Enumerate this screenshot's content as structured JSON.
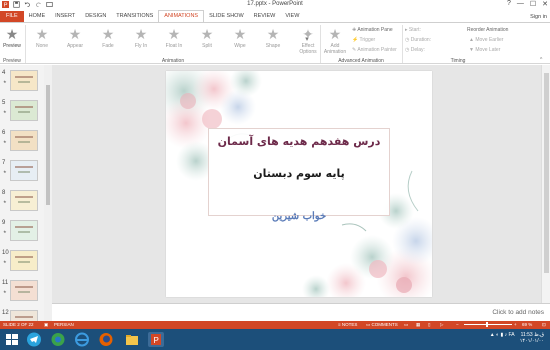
{
  "window": {
    "title": "17.pptx - PowerPoint",
    "controls": [
      "?",
      "—",
      "☐",
      "✕"
    ],
    "sign_in": "Sign in"
  },
  "tabs": [
    {
      "label": "FILE"
    },
    {
      "label": "HOME"
    },
    {
      "label": "INSERT"
    },
    {
      "label": "DESIGN"
    },
    {
      "label": "TRANSITIONS"
    },
    {
      "label": "ANIMATIONS"
    },
    {
      "label": "SLIDE SHOW"
    },
    {
      "label": "REVIEW"
    },
    {
      "label": "VIEW"
    }
  ],
  "active_tab": "ANIMATIONS",
  "ribbon": {
    "preview_label": "Preview",
    "preview_group": "Preview",
    "animations": [
      "None",
      "Appear",
      "Fade",
      "Fly In",
      "Float In",
      "Split",
      "Wipe",
      "Shape"
    ],
    "effect_options": "Effect Options",
    "animation_group": "Animation",
    "add_animation": "Add Animation",
    "animation_pane": "Animation Pane",
    "trigger": "Trigger",
    "animation_painter": "Animation Painter",
    "advanced_group": "Advanced Animation",
    "start": "Start:",
    "duration": "Duration:",
    "delay": "Delay:",
    "timing_group": "Timing",
    "reorder": "Reorder Animation",
    "move_earlier": "Move Earlier",
    "move_later": "Move Later"
  },
  "thumbnails": [
    {
      "num": "4",
      "star": "★"
    },
    {
      "num": "5",
      "star": "★"
    },
    {
      "num": "6",
      "star": "★"
    },
    {
      "num": "7",
      "star": "★"
    },
    {
      "num": "8",
      "star": "★"
    },
    {
      "num": "9",
      "star": "★"
    },
    {
      "num": "10",
      "star": "★"
    },
    {
      "num": "11",
      "star": "★"
    },
    {
      "num": "12",
      "star": ""
    }
  ],
  "slide": {
    "line1": "درس هفدهم هدیه های آسمان",
    "line2": "پایه سوم دبستان",
    "line3": "خواب شیرین"
  },
  "notes_placeholder": "Click to add notes",
  "status": {
    "slide_count": "SLIDE 2 OF 22",
    "language": "PERSIAN",
    "notes": "NOTES",
    "comments": "COMMENTS",
    "zoom": "69 %"
  },
  "tray": {
    "time": "11:53 ق.ظ",
    "date": "۱۴۰۱/۰۱/۰۰",
    "lang": "FA"
  },
  "colors": {
    "accent": "#d24726",
    "taskbar": "#1c4f7a"
  }
}
